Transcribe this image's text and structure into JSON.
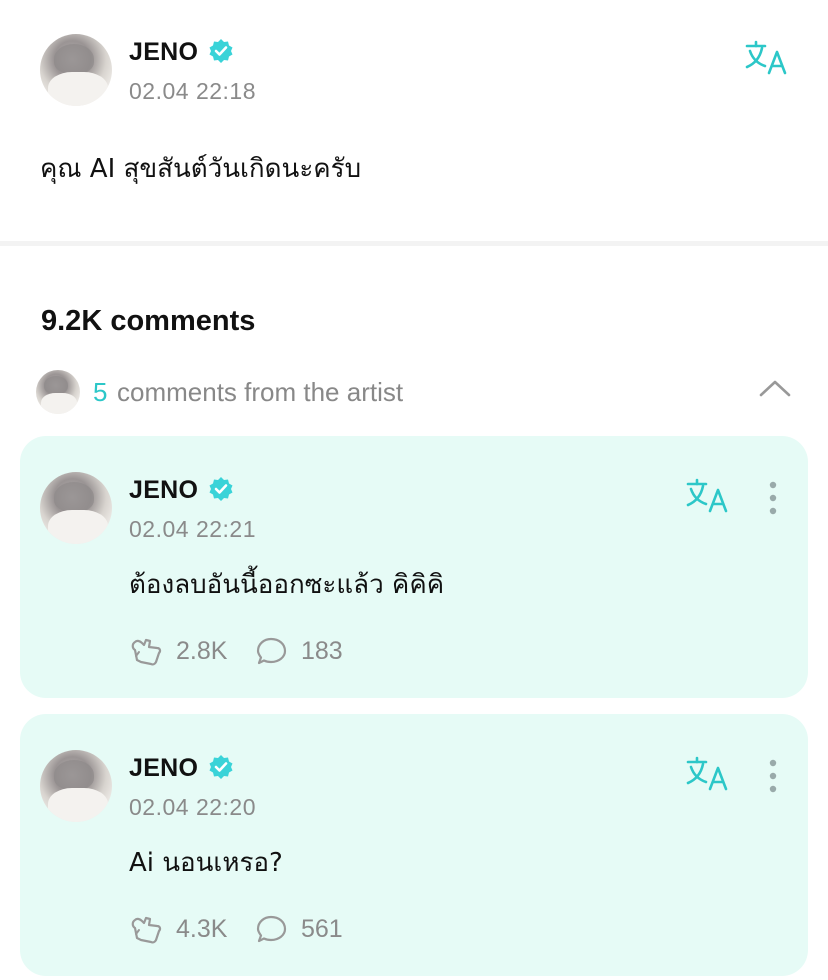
{
  "post": {
    "author": "JENO",
    "timestamp": "02.04 22:18",
    "text": "คุณ AI สุขสันต์วันเกิดนะครับ"
  },
  "comments_header": {
    "count_label": "9.2K comments",
    "artist_count": "5",
    "artist_label": "comments from the artist"
  },
  "comments": [
    {
      "author": "JENO",
      "timestamp": "02.04 22:21",
      "text": "ต้องลบอันนี้ออกซะแล้ว คิคิคิ",
      "likes": "2.8K",
      "replies": "183"
    },
    {
      "author": "JENO",
      "timestamp": "02.04 22:20",
      "text": "Ai นอนเหรอ?",
      "likes": "4.3K",
      "replies": "561"
    }
  ],
  "colors": {
    "accent": "#2cc7c8",
    "verified": "#3ad3d8",
    "card_bg": "#e6fbf6",
    "muted": "#8a8a8a"
  },
  "icons": {
    "verified": "verified-badge-icon",
    "translate": "translate-icon",
    "more": "more-vertical-icon",
    "like": "like-icon",
    "reply": "comment-bubble-icon",
    "collapse": "chevron-up-icon"
  }
}
